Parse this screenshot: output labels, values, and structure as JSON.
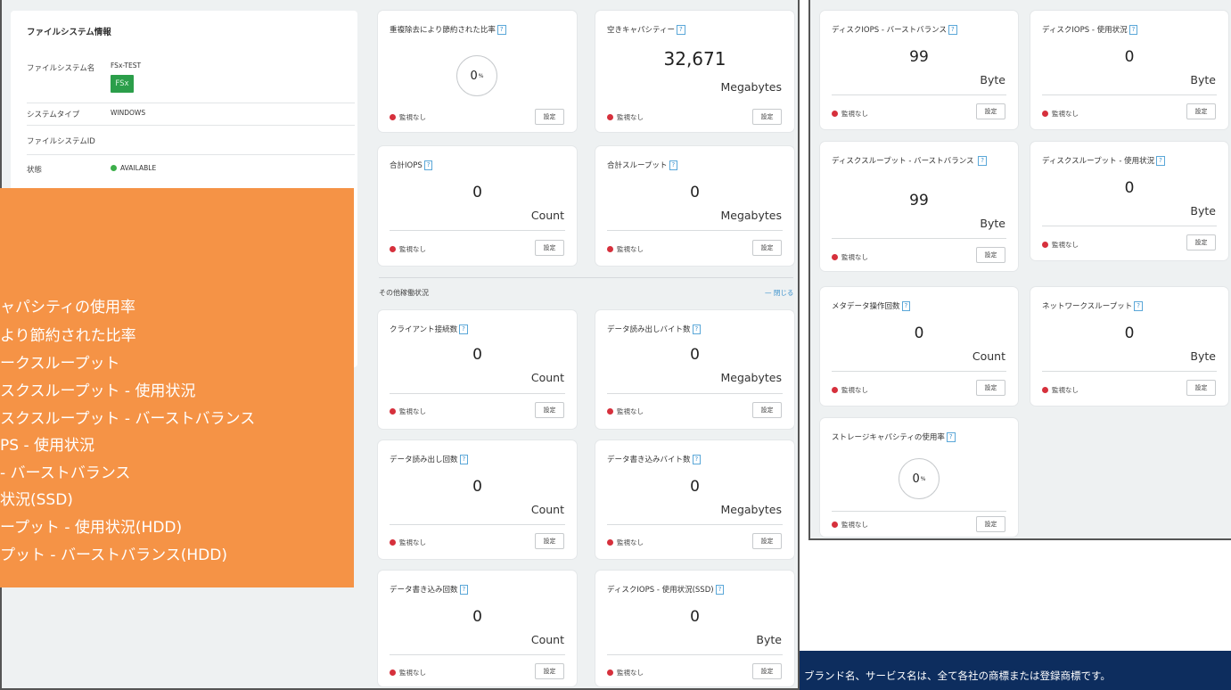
{
  "footer": {
    "text": "ブランド名、サービス名は、全て各社の商標または登録商標です。"
  },
  "info_panel": {
    "title": "ファイルシステム情報",
    "rows": [
      {
        "label": "ファイルシステム名",
        "value": "FSx-TEST"
      },
      {
        "label": "システムタイプ",
        "value": "WINDOWS"
      },
      {
        "label": "ファイルシステムID",
        "value": ""
      },
      {
        "label": "状態",
        "value": "AVAILABLE"
      }
    ],
    "logo_text": "FSx"
  },
  "common": {
    "help": "?",
    "status_unmonitored": "監視なし",
    "settings_button": "設定"
  },
  "main_cards": [
    {
      "title": "重複除去により節約された比率",
      "value": "0",
      "unit_small": "%",
      "unit": ""
    },
    {
      "title": "空きキャパシティー",
      "value": "32,671",
      "unit": "Megabytes"
    },
    {
      "title": "合計IOPS",
      "value": "0",
      "unit": "Count"
    },
    {
      "title": "合計スループット",
      "value": "0",
      "unit": "Megabytes"
    }
  ],
  "section": {
    "title": "その他稼働状況",
    "toggle": "— 閉じる"
  },
  "other_cards": [
    {
      "title": "クライアント接続数",
      "value": "0",
      "unit": "Count"
    },
    {
      "title": "データ読み出しバイト数",
      "value": "0",
      "unit": "Megabytes"
    },
    {
      "title": "データ読み出し回数",
      "value": "0",
      "unit": "Count"
    },
    {
      "title": "データ書き込みバイト数",
      "value": "0",
      "unit": "Megabytes"
    },
    {
      "title": "データ書き込み回数",
      "value": "0",
      "unit": "Count"
    },
    {
      "title": "ディスクIOPS - 使用状況(SSD)",
      "value": "0",
      "unit": "Byte"
    }
  ],
  "right_cards": [
    {
      "title": "ディスクIOPS - バーストバランス",
      "value": "99",
      "unit": "Byte"
    },
    {
      "title": "ディスクIOPS - 使用状況",
      "value": "0",
      "unit": "Byte"
    },
    {
      "title": "ディスクスループット - バーストバランス",
      "value": "99",
      "unit": "Byte"
    },
    {
      "title": "ディスクスループット - 使用状況",
      "value": "0",
      "unit": "Byte"
    },
    {
      "title": "メタデータ操作回数",
      "value": "0",
      "unit": "Count"
    },
    {
      "title": "ネットワークスループット",
      "value": "0",
      "unit": "Byte"
    },
    {
      "title": "ストレージキャパシティの使用率",
      "value": "0",
      "unit_small": "%",
      "unit": ""
    }
  ],
  "overlay": {
    "items": [
      "ャパシティの使用率",
      "より節約された比率",
      "ークスループット",
      "スクスループット - 使用状況",
      "スクスループット - バーストバランス",
      "PS - 使用状況",
      " - バーストバランス",
      "状況(SSD)",
      "ープット - 使用状況(HDD)",
      "プット - バーストバランス(HDD)"
    ],
    "color": "#f59346"
  },
  "colors": {
    "footer": "#0d2d5e",
    "accent": "#3b91cc",
    "alert": "#d6303c",
    "ok": "#3cae4a"
  }
}
